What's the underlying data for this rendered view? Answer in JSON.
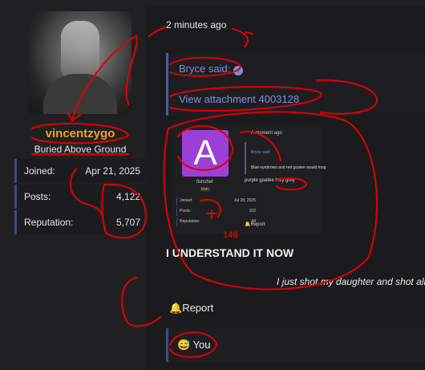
{
  "post": {
    "time": "2 minutes ago",
    "author": {
      "username": "vincentzygo",
      "title": "Buried Above Ground",
      "stats": [
        {
          "label": "Joined:",
          "value": "Apr 21, 2025"
        },
        {
          "label": "Posts:",
          "value": "4,122"
        },
        {
          "label": "Reputation:",
          "value": "5,707"
        }
      ]
    },
    "quote": {
      "said": "Bryce said:",
      "link": "View attachment 4003128"
    },
    "heading": "I UNDERSTAND IT NOW",
    "signature": "I just shot my daughter and shot all",
    "report": "Report",
    "reaction": "You"
  },
  "attachment": {
    "avatar_letter": "A",
    "username": "fishchef",
    "title": "Iron",
    "time": "A moment ago",
    "quote_said": "Bryce said:",
    "quote_text": "Blue eyebrows and red goatee would mog",
    "message": "purple goatee holy grey",
    "stats": [
      {
        "label": "Joined:",
        "value": "Jul 28, 2025"
      },
      {
        "label": "Posts:",
        "value": "102"
      },
      {
        "label": "Reputation:",
        "value": "94"
      }
    ],
    "report": "Report",
    "annotation": "146"
  },
  "icons": {
    "report": "bell-icon",
    "reaction": "grin-sweat-emoji",
    "quote_arrow": "up-arrow-icon"
  },
  "colors": {
    "username": "#f0a020",
    "link": "#7b8fe0",
    "avatar_bg": "#9b3fd6",
    "scribble": "#e00000"
  }
}
